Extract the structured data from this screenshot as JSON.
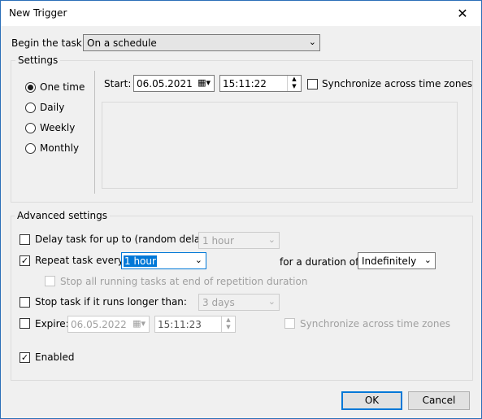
{
  "window": {
    "title": "New Trigger",
    "close_glyph": "✕"
  },
  "begin": {
    "label": "Begin the task:",
    "value": "On a schedule"
  },
  "settings": {
    "group_label": "Settings",
    "radios": [
      {
        "label": "One time",
        "checked": true
      },
      {
        "label": "Daily",
        "checked": false
      },
      {
        "label": "Weekly",
        "checked": false
      },
      {
        "label": "Monthly",
        "checked": false
      }
    ],
    "start_label": "Start:",
    "start_date": "06.05.2021",
    "start_time": "15:11:22",
    "sync_label": "Synchronize across time zones"
  },
  "advanced": {
    "group_label": "Advanced settings",
    "delay_label": "Delay task for up to (random delay):",
    "delay_value": "1 hour",
    "repeat_label": "Repeat task every:",
    "repeat_value": "1 hour",
    "duration_label": "for a duration of:",
    "duration_value": "Indefinitely",
    "stop_all_label": "Stop all running tasks at end of repetition duration",
    "stop_longer_label": "Stop task if it runs longer than:",
    "stop_longer_value": "3 days",
    "expire_label": "Expire:",
    "expire_date": "06.05.2022",
    "expire_time": "15:11:23",
    "expire_sync_label": "Synchronize across time zones",
    "enabled_label": "Enabled"
  },
  "buttons": {
    "ok": "OK",
    "cancel": "Cancel"
  },
  "colors": {
    "accent": "#0078d7"
  },
  "icons": [
    "close-icon",
    "chevron-down-icon",
    "calendar-icon",
    "spin-up-icon",
    "spin-down-icon",
    "checkmark-icon"
  ]
}
